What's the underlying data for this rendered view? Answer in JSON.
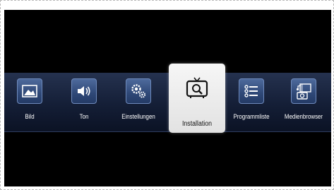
{
  "menu": {
    "items": [
      {
        "label": "Bild",
        "icon": "picture-icon"
      },
      {
        "label": "Ton",
        "icon": "speaker-icon"
      },
      {
        "label": "Einstellungen",
        "icon": "gears-icon"
      },
      {
        "label": "Installation",
        "icon": "tv-search-icon",
        "selected": true
      },
      {
        "label": "Programmliste",
        "icon": "list-icon"
      },
      {
        "label": "Medienbrowser",
        "icon": "media-icon"
      }
    ]
  },
  "colors": {
    "background": "#000000",
    "bar": "#1b2742",
    "tile": "#3a5587",
    "selected": "#eeeeee"
  }
}
